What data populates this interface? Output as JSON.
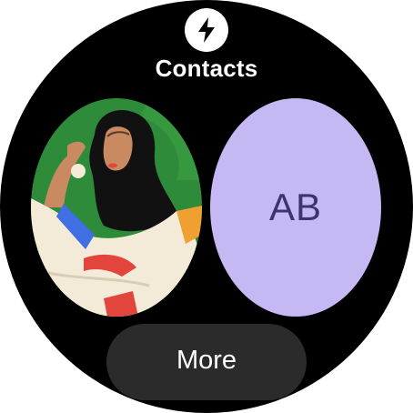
{
  "app": {
    "icon": "lightning-bolt-icon",
    "title": "Contacts"
  },
  "contacts": [
    {
      "type": "photo",
      "avatar": "illustrated-portrait-avatar",
      "colors": {
        "background": "#2e8b3a",
        "hijab": "#111111",
        "sweater": "#f3ead7",
        "accent_blue": "#3f6fe0",
        "accent_red": "#e2453c",
        "accent_orange": "#f0a030"
      }
    },
    {
      "type": "initials",
      "initials": "AB",
      "colors": {
        "background": "#c6b8f3",
        "text": "#3d3370"
      }
    }
  ],
  "more_button": {
    "label": "More"
  },
  "colors": {
    "screen_background": "#000000",
    "button_background": "#2b2b2b"
  }
}
